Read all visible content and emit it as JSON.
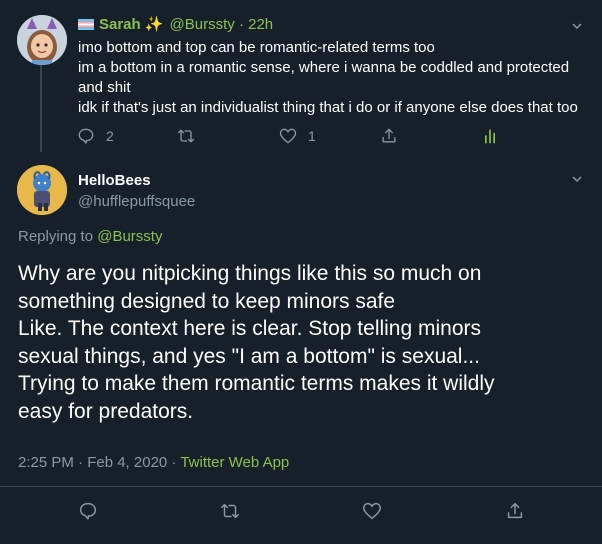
{
  "parent_tweet": {
    "display_name": "Sarah ✨",
    "handle_time": "@Burssty · 22h",
    "lines": [
      "imo bottom and top can be romantic-related terms too",
      "im a bottom in a romantic sense, where i wanna be coddled and protected",
      "and shit",
      "idk if that's just an individualist thing that i do or if anyone else does that too"
    ],
    "reply_count": "2",
    "retweet_count": "",
    "like_count": "1"
  },
  "reply_tweet": {
    "display_name": "HelloBees",
    "handle": "@hufflepuffsquee",
    "replying_prefix": "Replying to ",
    "replying_handle": "@Burssty",
    "lines": [
      "Why are you nitpicking things like this so much on",
      "something designed to keep minors safe",
      "Like. The context here is clear. Stop telling minors",
      "sexual things, and yes \"I am a bottom\" is sexual...",
      "Trying to make them romantic terms makes it wildly",
      "easy for predators."
    ],
    "timestamp": "2:25 PM · Feb 4, 2020 · ",
    "source": "Twitter Web App"
  },
  "icons": {
    "reply": "reply-icon",
    "retweet": "retweet-icon",
    "like": "heart-icon",
    "share": "share-icon",
    "analytics": "analytics-icon",
    "menu": "chevron-down-icon"
  },
  "colors": {
    "background": "#15202b",
    "accent": "#8bc34a",
    "muted": "#8899a6",
    "divider": "#38444d"
  }
}
